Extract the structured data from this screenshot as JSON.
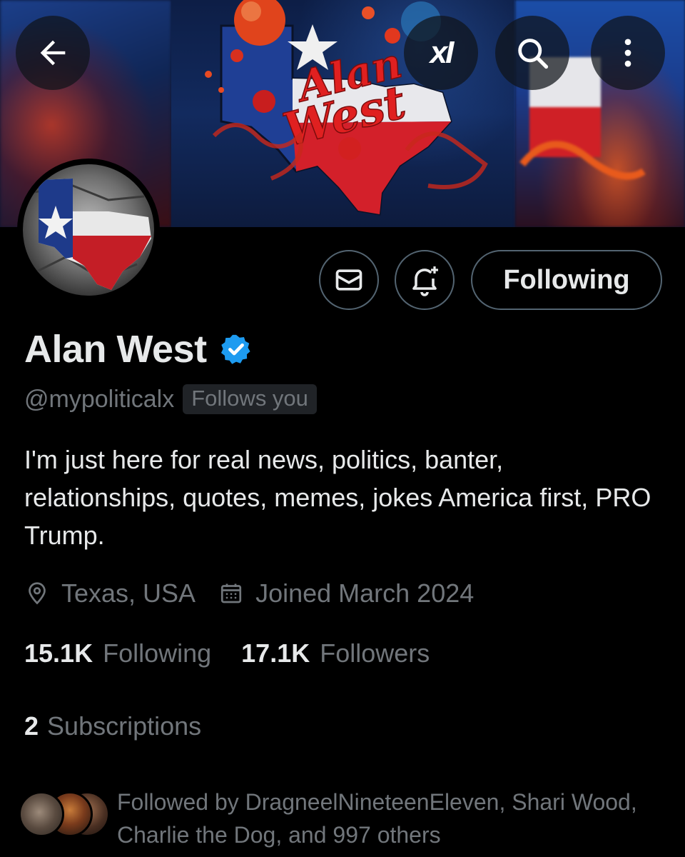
{
  "banner": {
    "art_title_line1": "Alan",
    "art_title_line2": "West"
  },
  "topbar": {
    "back_icon": "arrow-left-icon",
    "grok_label": "xI",
    "search_icon": "search-icon",
    "more_icon": "more-vertical-icon"
  },
  "actions": {
    "message_icon": "envelope-icon",
    "notify_icon": "bell-plus-icon",
    "following_label": "Following"
  },
  "profile": {
    "display_name": "Alan West",
    "verified": true,
    "handle": "@mypoliticalx",
    "follows_you": "Follows you",
    "bio": "I'm just here for real news, politics, banter, relationships, quotes, memes, jokes America first, PRO Trump.",
    "location": "Texas, USA",
    "joined": "Joined March 2024"
  },
  "stats": {
    "following_count": "15.1K",
    "following_label": "Following",
    "followers_count": "17.1K",
    "followers_label": "Followers",
    "subscriptions_count": "2",
    "subscriptions_label": "Subscriptions"
  },
  "followed_by": {
    "text": "Followed by DragneelNineteenEleven, Shari Wood, Charlie the Dog, and 997 others"
  },
  "colors": {
    "background": "#000000",
    "primary_text": "#e7e9ea",
    "secondary_text": "#71767b",
    "border": "#536471",
    "verified_blue": "#1d9bf0"
  }
}
